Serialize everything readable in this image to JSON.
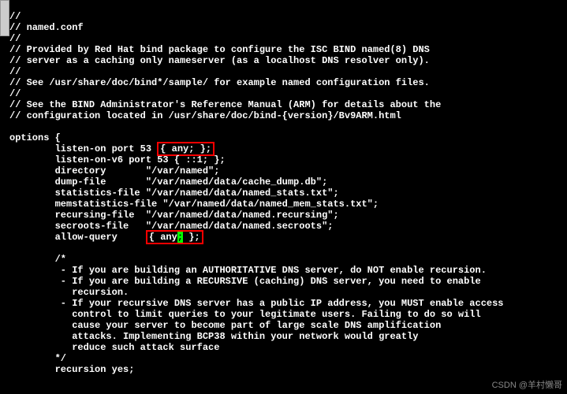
{
  "comments": {
    "l1": "//",
    "l2": "// named.conf",
    "l3": "//",
    "l4": "// Provided by Red Hat bind package to configure the ISC BIND named(8) DNS",
    "l5": "// server as a caching only nameserver (as a localhost DNS resolver only).",
    "l6": "//",
    "l7": "// See /usr/share/doc/bind*/sample/ for example named configuration files.",
    "l8": "//",
    "l9": "// See the BIND Administrator's Reference Manual (ARM) for details about the",
    "l10": "// configuration located in /usr/share/doc/bind-{version}/Bv9ARM.html"
  },
  "options_open": "options {",
  "opt": {
    "listen_on_a": "        listen-on port 53 ",
    "listen_on_hl": "{ any; };",
    "listen_on_v6": "        listen-on-v6 port 53 { ::1; };",
    "directory": "        directory       \"/var/named\";",
    "dump_file": "        dump-file       \"/var/named/data/cache_dump.db\";",
    "stats_file": "        statistics-file \"/var/named/data/named_stats.txt\";",
    "memstats": "        memstatistics-file \"/var/named/data/named_mem_stats.txt\";",
    "recursing": "        recursing-file  \"/var/named/data/named.recursing\";",
    "secroots": "        secroots-file   \"/var/named/data/named.secroots\";",
    "allow_a": "        allow-query     ",
    "allow_hl_a": "{ any",
    "allow_cursor": ";",
    "allow_hl_b": " };"
  },
  "doc": {
    "open": "        /*",
    "b1": "         - If you are building an AUTHORITATIVE DNS server, do NOT enable recursion.",
    "b2": "         - If you are building a RECURSIVE (caching) DNS server, you need to enable",
    "b2b": "           recursion.",
    "b3": "         - If your recursive DNS server has a public IP address, you MUST enable access",
    "b3b": "           control to limit queries to your legitimate users. Failing to do so will",
    "b3c": "           cause your server to become part of large scale DNS amplification",
    "b3d": "           attacks. Implementing BCP38 within your network would greatly",
    "b3e": "           reduce such attack surface",
    "close": "        */",
    "rec": "        recursion yes;"
  },
  "watermark": "CSDN @羊村懒哥"
}
